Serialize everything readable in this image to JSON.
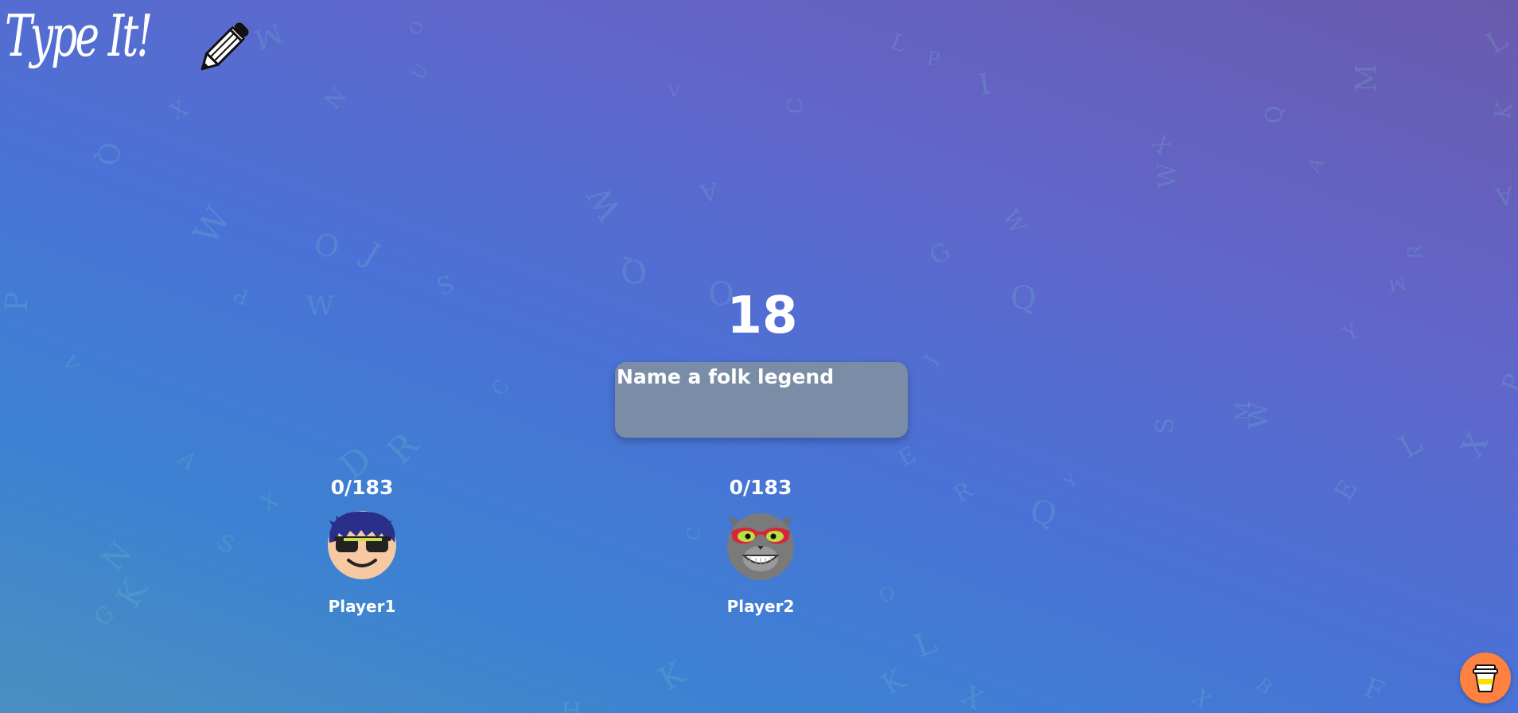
{
  "app": {
    "title": "Type It!"
  },
  "game": {
    "timer": "18",
    "prompt": "Name a folk legend"
  },
  "players": [
    {
      "name": "Player1",
      "score": "0/183",
      "avatar": "boy-with-sunglasses"
    },
    {
      "name": "Player2",
      "score": "0/183",
      "avatar": "cat-with-sunglasses"
    }
  ],
  "icons": {
    "logo": "pencil-icon",
    "support": "coffee-cup-icon"
  },
  "colors": {
    "background_start": "#4a90c0",
    "background_end": "#6a5aae",
    "prompt_box": "#7b8da6",
    "support_button": "#ff813f"
  }
}
